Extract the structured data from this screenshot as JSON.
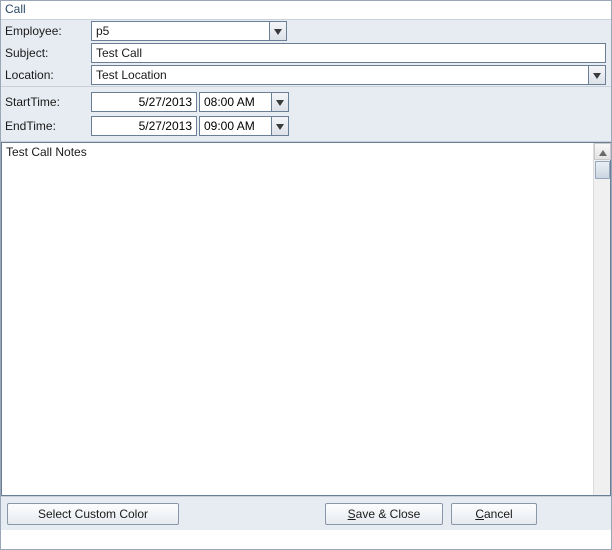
{
  "title": "Call",
  "labels": {
    "employee": "Employee:",
    "subject": "Subject:",
    "location": "Location:",
    "startTime": "StartTime:",
    "endTime": "EndTime:"
  },
  "fields": {
    "employee": "p5",
    "subject": "Test Call",
    "location": "Test Location",
    "startDate": "5/27/2013",
    "startTime": "08:00 AM",
    "endDate": "5/27/2013",
    "endTime": "09:00 AM",
    "notes": "Test Call Notes"
  },
  "buttons": {
    "selectColor": "Select Custom Color",
    "save": "Save & Close",
    "saveAccessKey": "S",
    "saveRest": "ave & Close",
    "cancelAccessKey": "C",
    "cancelRest": "ancel"
  }
}
